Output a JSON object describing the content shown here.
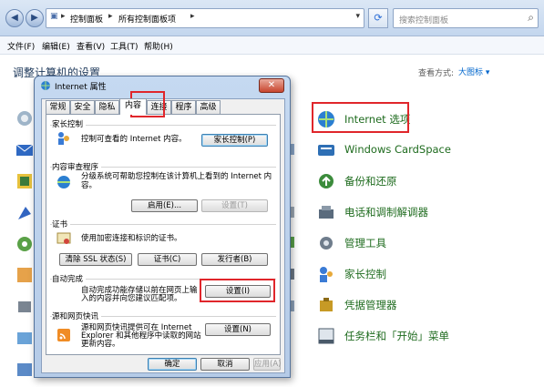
{
  "address": {
    "crumbs": [
      "控制面板",
      "所有控制面板项"
    ],
    "search_placeholder": "搜索控制面板"
  },
  "menu": [
    "文件(F)",
    "编辑(E)",
    "查看(V)",
    "工具(T)",
    "帮助(H)"
  ],
  "cp": {
    "title": "调整计算机的设置",
    "view_label": "查看方式:",
    "view_value": "大图标 ▾",
    "items": [
      {
        "label": "Internet 选项",
        "icon": "internet-options-icon",
        "color": "#2b7fd1"
      },
      {
        "label": "Windows CardSpace",
        "icon": "cardspace-icon",
        "color": "#2e6fb5"
      },
      {
        "label": "备份和还原",
        "icon": "backup-icon",
        "color": "#3c8c3c"
      },
      {
        "label": "电话和调制解调器",
        "icon": "phone-modem-icon",
        "color": "#5a6b7d"
      },
      {
        "label": "管理工具",
        "icon": "admin-tools-icon",
        "color": "#6f7d8c"
      },
      {
        "label": "家长控制",
        "icon": "parental-controls-icon",
        "color": "#3a7bd5"
      },
      {
        "label": "凭据管理器",
        "icon": "credential-manager-icon",
        "color": "#c79a25"
      },
      {
        "label": "任务栏和「开始」菜单",
        "icon": "taskbar-icon",
        "color": "#4a5a6a"
      }
    ],
    "highlight_color": "#e0262b"
  },
  "dialog": {
    "title": "Internet 属性",
    "close": "✕",
    "tabs": [
      "常规",
      "安全",
      "隐私",
      "内容",
      "连接",
      "程序",
      "高级"
    ],
    "active_tab": "内容",
    "groups": {
      "parental": {
        "title": "家长控制",
        "text": "控制可查看的 Internet 内容。",
        "button": "家长控制(P)"
      },
      "advisor": {
        "title": "内容审查程序",
        "text1": "分级系统可帮助您控制在该计算机上看到的 Internet 内",
        "text2": "容。",
        "enable": "启用(E)...",
        "settings": "设置(T)"
      },
      "certs": {
        "title": "证书",
        "text": "使用加密连接和标识的证书。",
        "clear_ssl": "清除 SSL 状态(S)",
        "certs_btn": "证书(C)",
        "publishers": "发行者(B)"
      },
      "autocomplete": {
        "title": "自动完成",
        "text1": "自动完成功能存储以前在网页上输",
        "text2": "入的内容并向您建议匹配项。",
        "button": "设置(I)"
      },
      "feeds": {
        "title": "源和网页快讯",
        "text1": "源和网页快讯提供可在 Internet",
        "text2": "Explorer 和其他程序中读取的网站",
        "text3": "更新内容。",
        "button": "设置(N)"
      }
    },
    "footer": {
      "ok": "确定",
      "cancel": "取消",
      "apply": "应用(A)"
    }
  }
}
